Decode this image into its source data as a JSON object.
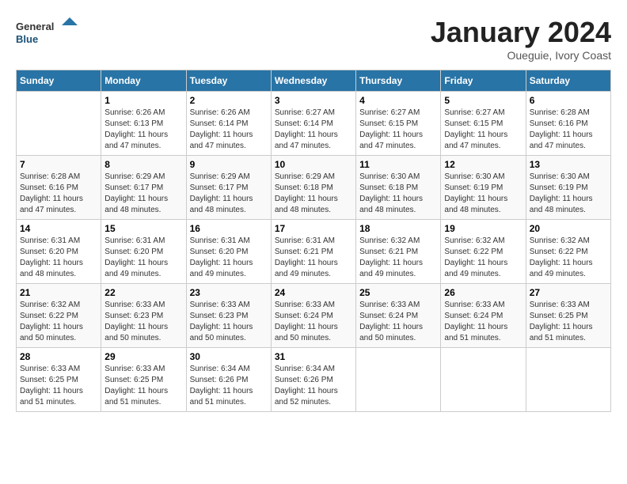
{
  "logo": {
    "general": "General",
    "blue": "Blue"
  },
  "title": "January 2024",
  "subtitle": "Oueguie, Ivory Coast",
  "days_header": [
    "Sunday",
    "Monday",
    "Tuesday",
    "Wednesday",
    "Thursday",
    "Friday",
    "Saturday"
  ],
  "weeks": [
    [
      {
        "day": "",
        "info": ""
      },
      {
        "day": "1",
        "info": "Sunrise: 6:26 AM\nSunset: 6:13 PM\nDaylight: 11 hours and 47 minutes."
      },
      {
        "day": "2",
        "info": "Sunrise: 6:26 AM\nSunset: 6:14 PM\nDaylight: 11 hours and 47 minutes."
      },
      {
        "day": "3",
        "info": "Sunrise: 6:27 AM\nSunset: 6:14 PM\nDaylight: 11 hours and 47 minutes."
      },
      {
        "day": "4",
        "info": "Sunrise: 6:27 AM\nSunset: 6:15 PM\nDaylight: 11 hours and 47 minutes."
      },
      {
        "day": "5",
        "info": "Sunrise: 6:27 AM\nSunset: 6:15 PM\nDaylight: 11 hours and 47 minutes."
      },
      {
        "day": "6",
        "info": "Sunrise: 6:28 AM\nSunset: 6:16 PM\nDaylight: 11 hours and 47 minutes."
      }
    ],
    [
      {
        "day": "7",
        "info": "Sunrise: 6:28 AM\nSunset: 6:16 PM\nDaylight: 11 hours and 47 minutes."
      },
      {
        "day": "8",
        "info": "Sunrise: 6:29 AM\nSunset: 6:17 PM\nDaylight: 11 hours and 48 minutes."
      },
      {
        "day": "9",
        "info": "Sunrise: 6:29 AM\nSunset: 6:17 PM\nDaylight: 11 hours and 48 minutes."
      },
      {
        "day": "10",
        "info": "Sunrise: 6:29 AM\nSunset: 6:18 PM\nDaylight: 11 hours and 48 minutes."
      },
      {
        "day": "11",
        "info": "Sunrise: 6:30 AM\nSunset: 6:18 PM\nDaylight: 11 hours and 48 minutes."
      },
      {
        "day": "12",
        "info": "Sunrise: 6:30 AM\nSunset: 6:19 PM\nDaylight: 11 hours and 48 minutes."
      },
      {
        "day": "13",
        "info": "Sunrise: 6:30 AM\nSunset: 6:19 PM\nDaylight: 11 hours and 48 minutes."
      }
    ],
    [
      {
        "day": "14",
        "info": "Sunrise: 6:31 AM\nSunset: 6:20 PM\nDaylight: 11 hours and 48 minutes."
      },
      {
        "day": "15",
        "info": "Sunrise: 6:31 AM\nSunset: 6:20 PM\nDaylight: 11 hours and 49 minutes."
      },
      {
        "day": "16",
        "info": "Sunrise: 6:31 AM\nSunset: 6:20 PM\nDaylight: 11 hours and 49 minutes."
      },
      {
        "day": "17",
        "info": "Sunrise: 6:31 AM\nSunset: 6:21 PM\nDaylight: 11 hours and 49 minutes."
      },
      {
        "day": "18",
        "info": "Sunrise: 6:32 AM\nSunset: 6:21 PM\nDaylight: 11 hours and 49 minutes."
      },
      {
        "day": "19",
        "info": "Sunrise: 6:32 AM\nSunset: 6:22 PM\nDaylight: 11 hours and 49 minutes."
      },
      {
        "day": "20",
        "info": "Sunrise: 6:32 AM\nSunset: 6:22 PM\nDaylight: 11 hours and 49 minutes."
      }
    ],
    [
      {
        "day": "21",
        "info": "Sunrise: 6:32 AM\nSunset: 6:22 PM\nDaylight: 11 hours and 50 minutes."
      },
      {
        "day": "22",
        "info": "Sunrise: 6:33 AM\nSunset: 6:23 PM\nDaylight: 11 hours and 50 minutes."
      },
      {
        "day": "23",
        "info": "Sunrise: 6:33 AM\nSunset: 6:23 PM\nDaylight: 11 hours and 50 minutes."
      },
      {
        "day": "24",
        "info": "Sunrise: 6:33 AM\nSunset: 6:24 PM\nDaylight: 11 hours and 50 minutes."
      },
      {
        "day": "25",
        "info": "Sunrise: 6:33 AM\nSunset: 6:24 PM\nDaylight: 11 hours and 50 minutes."
      },
      {
        "day": "26",
        "info": "Sunrise: 6:33 AM\nSunset: 6:24 PM\nDaylight: 11 hours and 51 minutes."
      },
      {
        "day": "27",
        "info": "Sunrise: 6:33 AM\nSunset: 6:25 PM\nDaylight: 11 hours and 51 minutes."
      }
    ],
    [
      {
        "day": "28",
        "info": "Sunrise: 6:33 AM\nSunset: 6:25 PM\nDaylight: 11 hours and 51 minutes."
      },
      {
        "day": "29",
        "info": "Sunrise: 6:33 AM\nSunset: 6:25 PM\nDaylight: 11 hours and 51 minutes."
      },
      {
        "day": "30",
        "info": "Sunrise: 6:34 AM\nSunset: 6:26 PM\nDaylight: 11 hours and 51 minutes."
      },
      {
        "day": "31",
        "info": "Sunrise: 6:34 AM\nSunset: 6:26 PM\nDaylight: 11 hours and 52 minutes."
      },
      {
        "day": "",
        "info": ""
      },
      {
        "day": "",
        "info": ""
      },
      {
        "day": "",
        "info": ""
      }
    ]
  ]
}
